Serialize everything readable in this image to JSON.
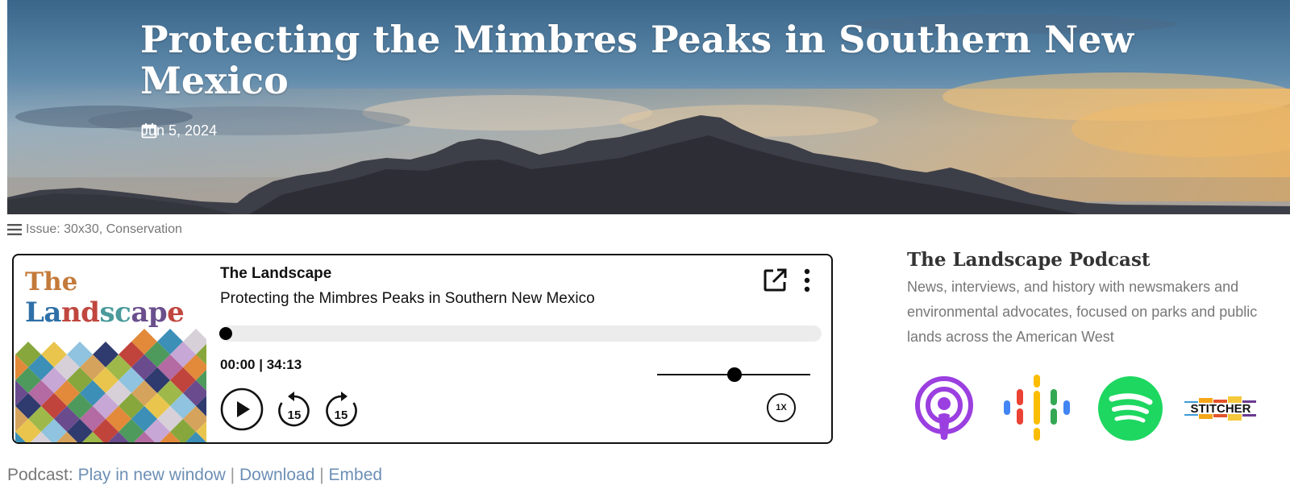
{
  "hero": {
    "title": "Protecting the Mimbres Peaks in Southern New Mexico",
    "date": "Jun 5, 2024"
  },
  "issue_line": {
    "text": "Issue: 30x30, Conservation"
  },
  "player": {
    "cover_the": "The",
    "cover_landscape_letters": [
      {
        "ch": "L",
        "color": "#2e6fa8"
      },
      {
        "ch": "a",
        "color": "#2e6fa8"
      },
      {
        "ch": "n",
        "color": "#c0463e"
      },
      {
        "ch": "d",
        "color": "#c0463e"
      },
      {
        "ch": "s",
        "color": "#4a9a9a"
      },
      {
        "ch": "c",
        "color": "#4a9a9a"
      },
      {
        "ch": "a",
        "color": "#6b4f8c"
      },
      {
        "ch": "p",
        "color": "#6b4f8c"
      },
      {
        "ch": "e",
        "color": "#c0463e"
      }
    ],
    "show_name": "The Landscape",
    "episode_title": "Protecting the Mimbres Peaks in Southern New Mexico",
    "current_time": "00:00",
    "duration": "34:13",
    "time_separator": "|",
    "progress_fraction": 0,
    "volume_fraction": 0.5,
    "speed": "1X",
    "skip_back_seconds": "15",
    "skip_forward_seconds": "15",
    "icons": [
      "popout-icon",
      "more-vertical-icon",
      "play-icon",
      "rewind-15-icon",
      "forward-15-icon"
    ]
  },
  "sidebar": {
    "title": "The Landscape Podcast",
    "description": "News, interviews, and history with newsmakers and environmental advocates, focused on parks and public lands across the American West",
    "apps": [
      {
        "name": "apple-podcasts-icon",
        "color": "#9b3fe0"
      },
      {
        "name": "google-podcasts-icon",
        "colors": [
          "#4285f4",
          "#ea4335",
          "#fbbc04",
          "#34a853"
        ]
      },
      {
        "name": "spotify-icon",
        "color": "#1ed760"
      },
      {
        "name": "stitcher-icon",
        "text": "STITCHER"
      }
    ]
  },
  "podcast_links": {
    "prefix": "Podcast:",
    "play_new_window": "Play in new window",
    "download": "Download",
    "embed": "Embed",
    "separator": "|"
  }
}
